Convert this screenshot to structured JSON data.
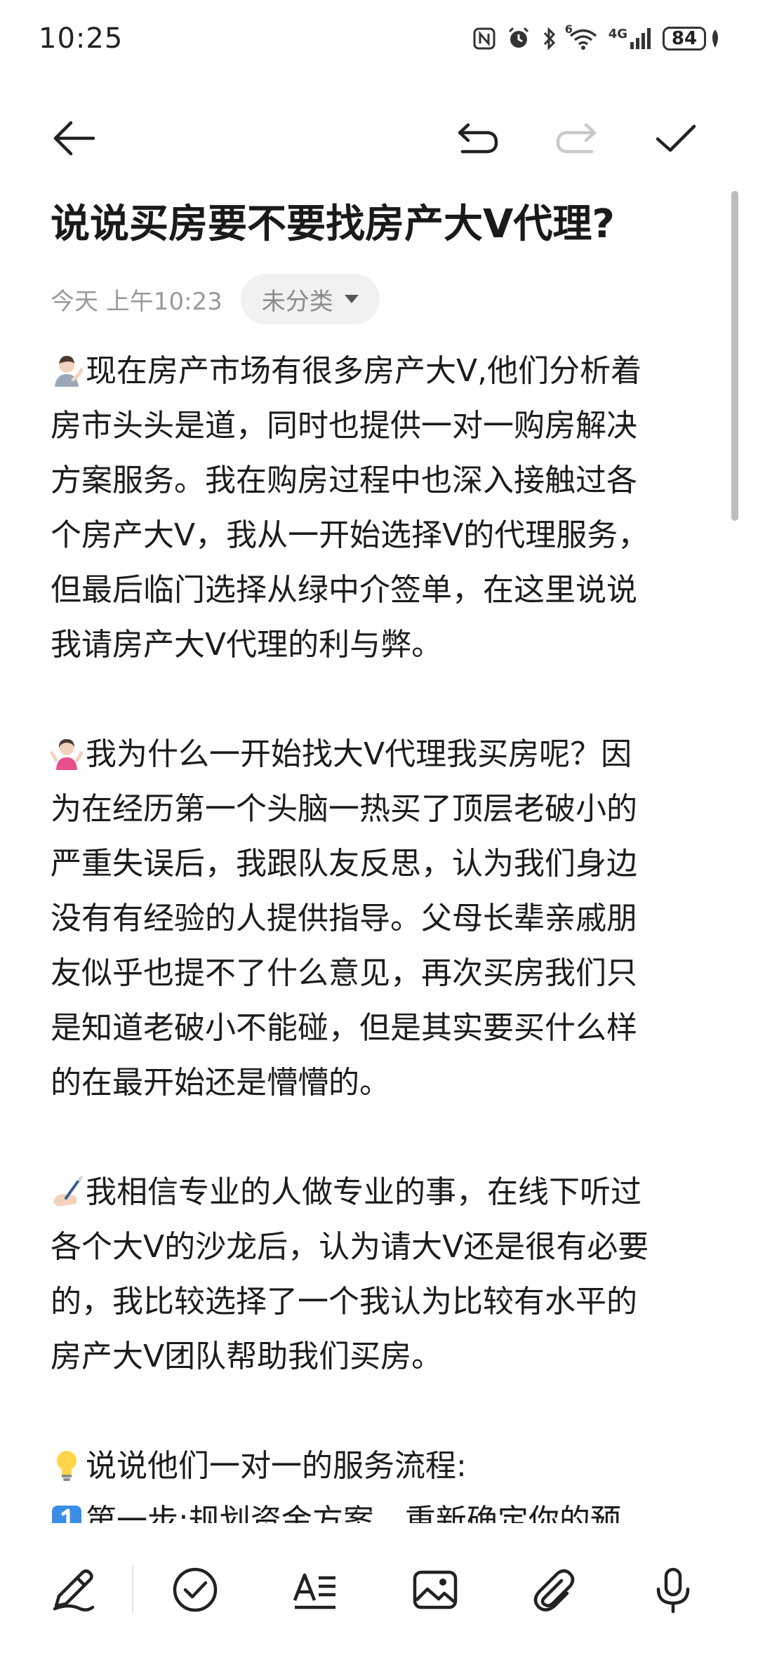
{
  "status_bar": {
    "time": "10:25",
    "network": "4G",
    "wifi_tag": "6",
    "battery": "84"
  },
  "toolbar": {
    "icons": [
      "back-arrow-icon",
      "undo-icon",
      "redo-icon",
      "check-icon"
    ]
  },
  "note": {
    "title": "说说买房要不要找房产大V代理?",
    "date": "今天 上午10:23",
    "category": "未分类",
    "paragraphs": [
      {
        "emoji": "person-tipping-hand-icon",
        "lines": [
          "现在房产市场有很多房产大V,他们分析着",
          "房市头头是道，同时也提供一对一购房解决",
          "方案服务。我在购房过程中也深入接触过各",
          "个房产大V，我从一开始选择V的代理服务，",
          "但最后临门选择从绿中介签单，在这里说说",
          "我请房产大V代理的利与弊。"
        ]
      },
      {
        "emoji": "person-shrugging-icon",
        "lines": [
          "我为什么一开始找大V代理我买房呢？因",
          "为在经历第一个头脑一热买了顶层老破小的",
          "严重失误后，我跟队友反思，认为我们身边",
          "没有有经验的人提供指导。父母长辈亲戚朋",
          "友似乎也提不了什么意见，再次买房我们只",
          "是知道老破小不能碰，但是其实要买什么样",
          "的在最开始还是懵懵的。"
        ]
      },
      {
        "emoji": "writing-hand-icon",
        "lines": [
          "我相信专业的人做专业的事，在线下听过",
          "各个大V的沙龙后，认为请大V还是很有必要",
          "的，我比较选择了一个我认为比较有水平的",
          "房产大V团队帮助我们买房。"
        ]
      },
      {
        "emoji": "light-bulb-icon",
        "lines": [
          "说说他们一对一的服务流程:"
        ]
      },
      {
        "emoji": "keycap-one-icon",
        "lines": [
          "第一步:规划资金方案，重新确定你的预"
        ]
      }
    ]
  },
  "bottom_bar": {
    "icons": [
      "pen-icon",
      "checklist-icon",
      "text-format-icon",
      "image-icon",
      "attachment-icon",
      "microphone-icon"
    ]
  }
}
